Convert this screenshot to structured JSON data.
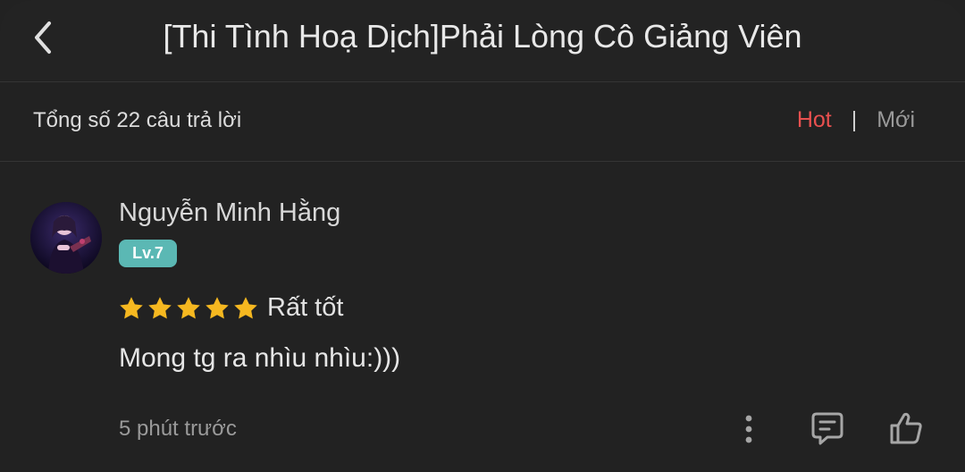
{
  "header": {
    "title": "[Thi Tình Hoạ Dịch]Phải Lòng Cô Giảng Viên",
    "back_icon": "chevron-left-icon"
  },
  "summary": {
    "total_text": "Tổng số 22 câu trả lời",
    "sort_hot": "Hot",
    "sort_separator": "|",
    "sort_new": "Mới",
    "active_color": "#e8504f"
  },
  "review": {
    "username": "Nguyễn Minh Hằng",
    "level": "Lv.7",
    "level_color": "#5bb8b4",
    "rating": 5,
    "rating_max": 5,
    "star_color": "#f6b820",
    "rating_label": "Rất tốt",
    "comment": "Mong tg ra nhìu nhìu:)))",
    "time": "5 phút trước",
    "actions": [
      "more-icon",
      "comment-icon",
      "like-icon"
    ]
  }
}
